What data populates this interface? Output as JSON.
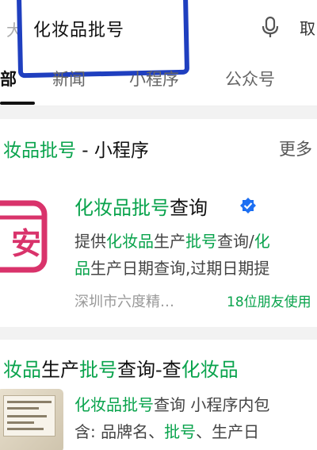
{
  "search": {
    "back_glyph": "大",
    "query": "化妆品批号",
    "action_label": "取"
  },
  "tabs": [
    "部",
    "新闻",
    "小程序",
    "公众号"
  ],
  "section": {
    "title_prefix": "妆品批号",
    "title_suffix": " - 小程序",
    "more_label": "更多"
  },
  "mini_program": {
    "name_prefix": "化妆品批号",
    "name_suffix": "查询",
    "logo_char": "安",
    "desc1_parts": [
      "提供",
      "化妆品",
      "生产",
      "批号",
      "查询/",
      "化"
    ],
    "desc2_parts": [
      "品",
      "生产日期查询,过期日期提"
    ],
    "meta": "深圳市六度精…",
    "friends": "18位朋友使用"
  },
  "result2": {
    "title_parts": [
      "妆品",
      "生产",
      "批号",
      "查询-查",
      "化妆品"
    ],
    "line1_parts": [
      "化妆品批号",
      "查询 小程序内包"
    ],
    "line2_parts": [
      "含: 品牌名、",
      "批号",
      "、生产日"
    ]
  },
  "colors": {
    "accent_green": "#09a34c",
    "highlight_blue": "#1f3fbf",
    "logo_pink": "#d9336b",
    "verified_blue": "#1d6ff2"
  }
}
